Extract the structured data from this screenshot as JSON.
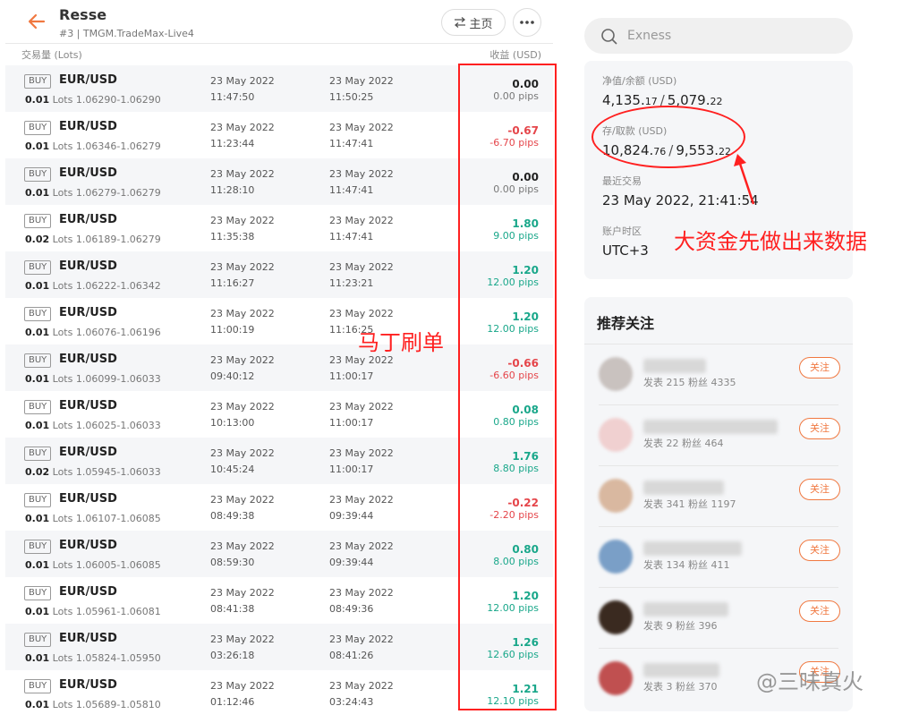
{
  "header": {
    "title": "Resse",
    "subtitle": "#3 | TMGM.TradeMax-Live4",
    "home_label": "主页"
  },
  "table_header": {
    "left": "交易量 (Lots)",
    "right": "收益 (USD)"
  },
  "trades": [
    {
      "side": "BUY",
      "symbol": "EUR/USD",
      "lots": "0.01",
      "lots_unit": "Lots",
      "range": "1.06290-1.06290",
      "open_date": "23 May 2022",
      "open_time": "11:47:50",
      "close_date": "23 May 2022",
      "close_time": "11:50:25",
      "profit": "0.00",
      "pips": "0.00 pips",
      "dir": "neu"
    },
    {
      "side": "BUY",
      "symbol": "EUR/USD",
      "lots": "0.01",
      "lots_unit": "Lots",
      "range": "1.06346-1.06279",
      "open_date": "23 May 2022",
      "open_time": "11:23:44",
      "close_date": "23 May 2022",
      "close_time": "11:47:41",
      "profit": "-0.67",
      "pips": "-6.70 pips",
      "dir": "neg"
    },
    {
      "side": "BUY",
      "symbol": "EUR/USD",
      "lots": "0.01",
      "lots_unit": "Lots",
      "range": "1.06279-1.06279",
      "open_date": "23 May 2022",
      "open_time": "11:28:10",
      "close_date": "23 May 2022",
      "close_time": "11:47:41",
      "profit": "0.00",
      "pips": "0.00 pips",
      "dir": "neu"
    },
    {
      "side": "BUY",
      "symbol": "EUR/USD",
      "lots": "0.02",
      "lots_unit": "Lots",
      "range": "1.06189-1.06279",
      "open_date": "23 May 2022",
      "open_time": "11:35:38",
      "close_date": "23 May 2022",
      "close_time": "11:47:41",
      "profit": "1.80",
      "pips": "9.00 pips",
      "dir": "pos"
    },
    {
      "side": "BUY",
      "symbol": "EUR/USD",
      "lots": "0.01",
      "lots_unit": "Lots",
      "range": "1.06222-1.06342",
      "open_date": "23 May 2022",
      "open_time": "11:16:27",
      "close_date": "23 May 2022",
      "close_time": "11:23:21",
      "profit": "1.20",
      "pips": "12.00 pips",
      "dir": "pos"
    },
    {
      "side": "BUY",
      "symbol": "EUR/USD",
      "lots": "0.01",
      "lots_unit": "Lots",
      "range": "1.06076-1.06196",
      "open_date": "23 May 2022",
      "open_time": "11:00:19",
      "close_date": "23 May 2022",
      "close_time": "11:16:25",
      "profit": "1.20",
      "pips": "12.00 pips",
      "dir": "pos"
    },
    {
      "side": "BUY",
      "symbol": "EUR/USD",
      "lots": "0.01",
      "lots_unit": "Lots",
      "range": "1.06099-1.06033",
      "open_date": "23 May 2022",
      "open_time": "09:40:12",
      "close_date": "23 May 2022",
      "close_time": "11:00:17",
      "profit": "-0.66",
      "pips": "-6.60 pips",
      "dir": "neg"
    },
    {
      "side": "BUY",
      "symbol": "EUR/USD",
      "lots": "0.01",
      "lots_unit": "Lots",
      "range": "1.06025-1.06033",
      "open_date": "23 May 2022",
      "open_time": "10:13:00",
      "close_date": "23 May 2022",
      "close_time": "11:00:17",
      "profit": "0.08",
      "pips": "0.80 pips",
      "dir": "pos"
    },
    {
      "side": "BUY",
      "symbol": "EUR/USD",
      "lots": "0.02",
      "lots_unit": "Lots",
      "range": "1.05945-1.06033",
      "open_date": "23 May 2022",
      "open_time": "10:45:24",
      "close_date": "23 May 2022",
      "close_time": "11:00:17",
      "profit": "1.76",
      "pips": "8.80 pips",
      "dir": "pos"
    },
    {
      "side": "BUY",
      "symbol": "EUR/USD",
      "lots": "0.01",
      "lots_unit": "Lots",
      "range": "1.06107-1.06085",
      "open_date": "23 May 2022",
      "open_time": "08:49:38",
      "close_date": "23 May 2022",
      "close_time": "09:39:44",
      "profit": "-0.22",
      "pips": "-2.20 pips",
      "dir": "neg"
    },
    {
      "side": "BUY",
      "symbol": "EUR/USD",
      "lots": "0.01",
      "lots_unit": "Lots",
      "range": "1.06005-1.06085",
      "open_date": "23 May 2022",
      "open_time": "08:59:30",
      "close_date": "23 May 2022",
      "close_time": "09:39:44",
      "profit": "0.80",
      "pips": "8.00 pips",
      "dir": "pos"
    },
    {
      "side": "BUY",
      "symbol": "EUR/USD",
      "lots": "0.01",
      "lots_unit": "Lots",
      "range": "1.05961-1.06081",
      "open_date": "23 May 2022",
      "open_time": "08:41:38",
      "close_date": "23 May 2022",
      "close_time": "08:49:36",
      "profit": "1.20",
      "pips": "12.00 pips",
      "dir": "pos"
    },
    {
      "side": "BUY",
      "symbol": "EUR/USD",
      "lots": "0.01",
      "lots_unit": "Lots",
      "range": "1.05824-1.05950",
      "open_date": "23 May 2022",
      "open_time": "03:26:18",
      "close_date": "23 May 2022",
      "close_time": "08:41:26",
      "profit": "1.26",
      "pips": "12.60 pips",
      "dir": "pos"
    },
    {
      "side": "BUY",
      "symbol": "EUR/USD",
      "lots": "0.01",
      "lots_unit": "Lots",
      "range": "1.05689-1.05810",
      "open_date": "23 May 2022",
      "open_time": "01:12:46",
      "close_date": "23 May 2022",
      "close_time": "03:24:43",
      "profit": "1.21",
      "pips": "12.10 pips",
      "dir": "pos"
    }
  ],
  "annotation_left": "马丁刷单",
  "search": {
    "placeholder": "Exness"
  },
  "account": {
    "equity_label": "净值/余额 (USD)",
    "equity_main": "4,135.",
    "equity_dec": "17",
    "balance_main": "5,079.",
    "balance_dec": "22",
    "deposit_label": "存/取款 (USD)",
    "deposit_main": "10,824.",
    "deposit_dec": "76",
    "withdraw_main": "9,553.",
    "withdraw_dec": "22",
    "separator": "/",
    "last_trade_label": "最近交易",
    "last_trade_value": "23 May 2022, 21:41:54",
    "timezone_label": "账户时区",
    "timezone_value": "UTC+3"
  },
  "annotation_right": "大资金先做出来数据",
  "recommend": {
    "title": "推荐关注",
    "follow_label": "关注",
    "items": [
      {
        "stats": "发表 215   粉丝 4335"
      },
      {
        "stats": "发表 22   粉丝 464"
      },
      {
        "stats": "发表 341   粉丝 1197"
      },
      {
        "stats": "发表 134   粉丝 411"
      },
      {
        "stats": "发表 9   粉丝 396"
      },
      {
        "stats": "发表 3   粉丝 370"
      }
    ]
  },
  "watermark": "@三味真火",
  "colors": {
    "accent": "#f07840",
    "positive": "#19a78a",
    "negative": "#e5454a",
    "annotation": "#ff2020"
  }
}
